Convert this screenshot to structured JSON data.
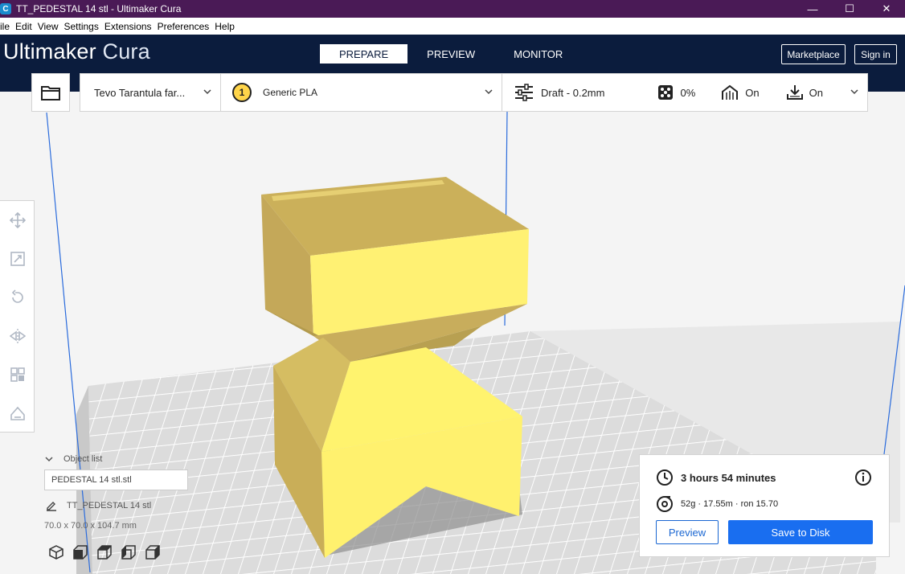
{
  "window": {
    "title": "TT_PEDESTAL 14 stl - Ultimaker Cura",
    "app_icon_letter": "C",
    "minimize": "—",
    "maximize": "☐",
    "close": "✕"
  },
  "menu": {
    "items": [
      "ile",
      "Edit",
      "View",
      "Settings",
      "Extensions",
      "Preferences",
      "Help"
    ]
  },
  "header": {
    "brand_main": "Ultimaker",
    "brand_sub": "Cura",
    "stages": [
      "PREPARE",
      "PREVIEW",
      "MONITOR"
    ],
    "marketplace": "Marketplace",
    "sign_in": "Sign in"
  },
  "toolbar": {
    "printer": "Tevo Tarantula far...",
    "extruder_number": "1",
    "material": "Generic PLA",
    "profile": "Draft - 0.2mm",
    "infill": "0%",
    "support": "On",
    "adhesion": "On"
  },
  "object_list": {
    "header": "Object list",
    "file_field": "PEDESTAL 14 stl.stl",
    "object_name": "TT_PEDESTAL 14 stl",
    "dimensions": "70.0 x 70.0 x 104.7 mm"
  },
  "print_panel": {
    "time": "3 hours 54 minutes",
    "material_info": "52g · 17.55m · ron 15.70",
    "preview_button": "Preview",
    "save_button": "Save to Disk"
  },
  "colors": {
    "header_bg": "#0b1c3d",
    "titlebar_bg": "#4a1a56",
    "model_yellow": "#ffe96a",
    "accent_blue": "#196ef0"
  }
}
